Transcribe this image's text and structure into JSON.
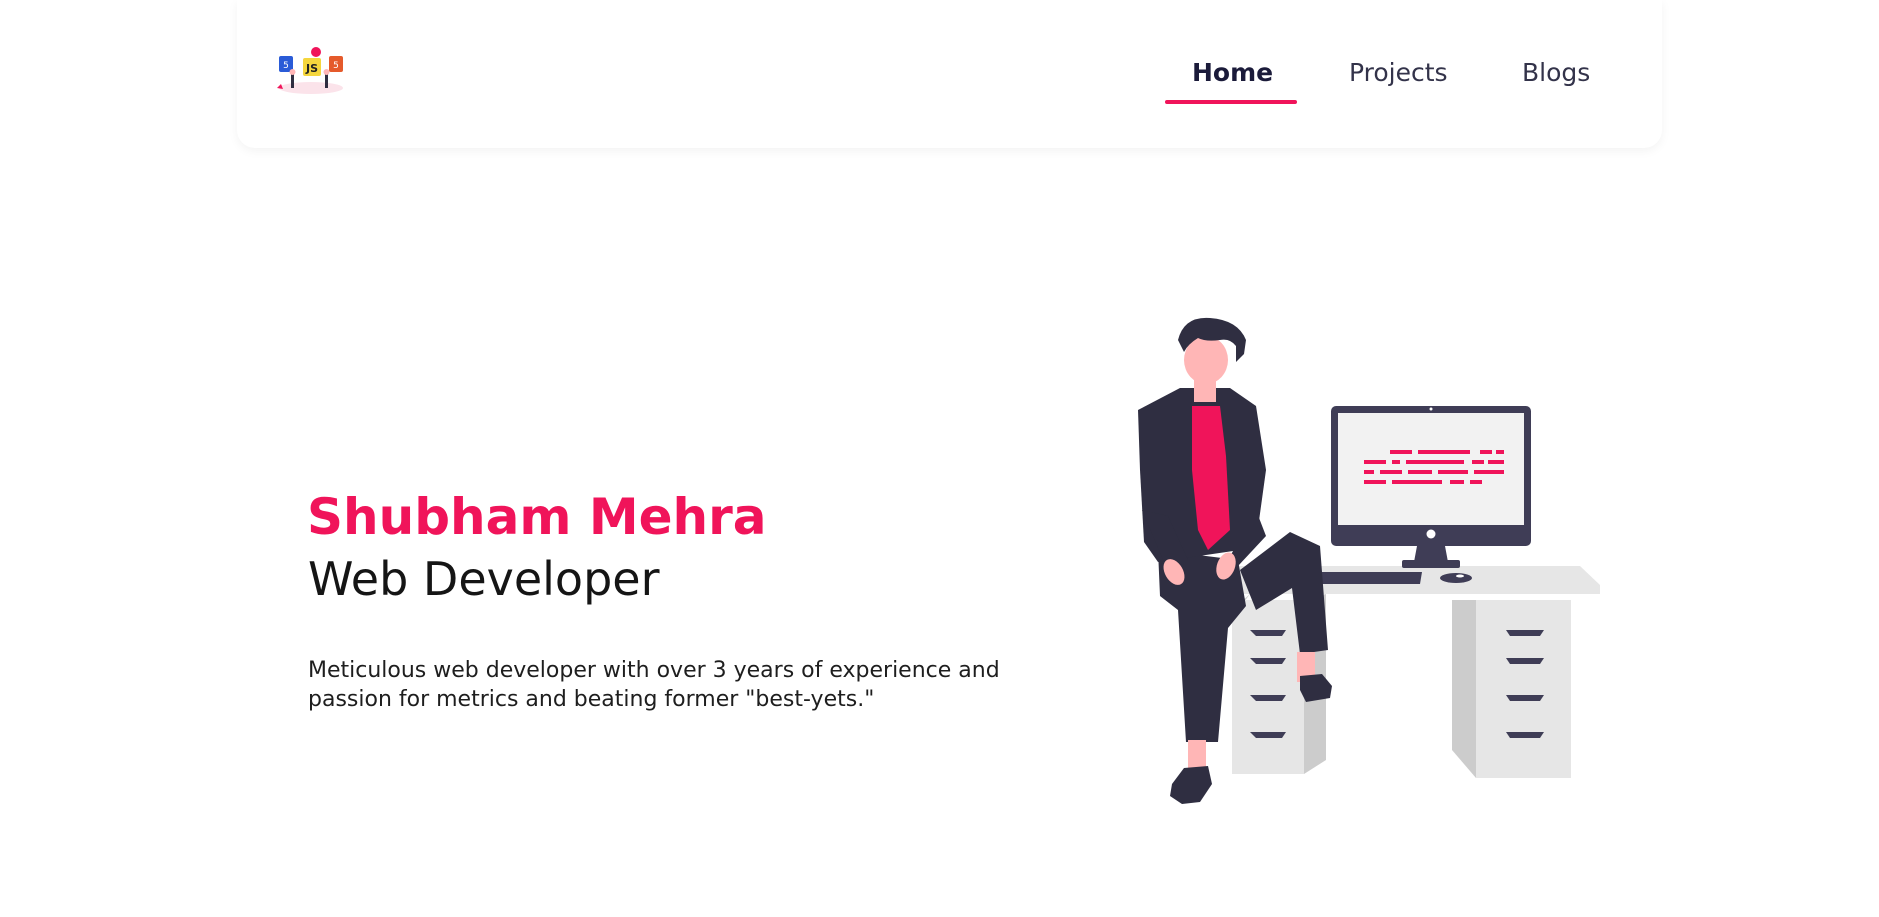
{
  "header": {
    "logo_text": "JS",
    "logo_badges": [
      "5",
      "5"
    ],
    "nav": [
      {
        "label": "Home",
        "active": true
      },
      {
        "label": "Projects",
        "active": false
      },
      {
        "label": "Blogs",
        "active": false
      }
    ]
  },
  "hero": {
    "name": "Shubham Mehra",
    "role": "Web Developer",
    "description": "Meticulous web developer with over 3 years of experience and passion for metrics and beating former \"best-yets.\""
  },
  "illustration": {
    "subject": "person-sitting-at-desk"
  },
  "colors": {
    "accent": "#f0145a",
    "dark": "#2f2e41",
    "desk": "#e6e6e6",
    "desk_shadow": "#cccccc",
    "skin": "#ffb6b6",
    "js_yellow": "#f5d63d",
    "css_blue": "#2a5bd7",
    "html_orange": "#e55a2b"
  }
}
